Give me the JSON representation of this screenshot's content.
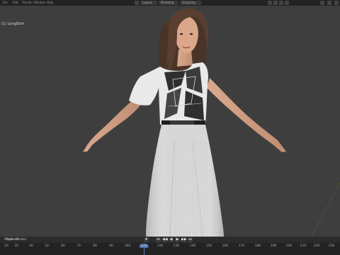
{
  "topbar": {
    "menus": [
      "File",
      "Edit",
      "Render",
      "Window",
      "Help",
      "Layout",
      "Modeling",
      "Sculpting"
    ]
  },
  "viewport": {
    "view_label": "User Persp",
    "object_label": "(1) LongSkirt"
  },
  "timeline": {
    "menus": [
      "Playback",
      "View",
      "Marker"
    ],
    "controls": [
      "⏺",
      "⏮",
      "◀◀",
      "◀",
      "▶",
      "▶▶",
      "⏭"
    ],
    "ticks": [
      "20",
      "30",
      "40",
      "50",
      "60",
      "70",
      "80",
      "90",
      "100",
      "110",
      "120",
      "130",
      "140",
      "150",
      "160",
      "170",
      "180",
      "190",
      "200",
      "210",
      "220",
      "230",
      "240"
    ],
    "current_frame": "110"
  },
  "colors": {
    "background": "#3e3e3e",
    "header": "#232323",
    "accent": "#5680c2"
  }
}
